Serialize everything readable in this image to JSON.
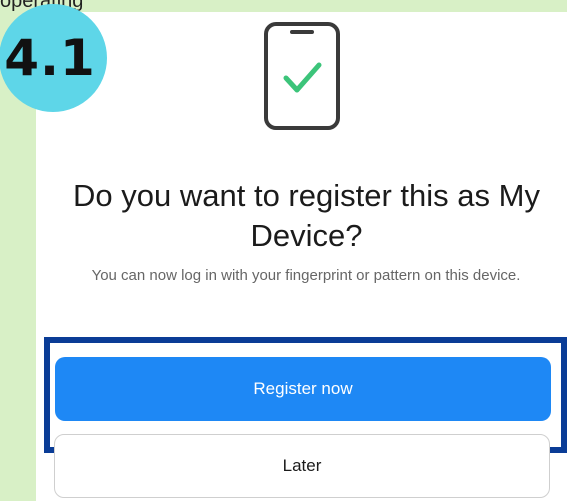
{
  "caption": "operating",
  "step_badge": "4.1",
  "icons": {
    "device": "smartphone-check-icon"
  },
  "colors": {
    "page_background": "#d8f0c6",
    "badge": "#5ed6e8",
    "primary_button": "#1e88f5",
    "highlight_frame": "#0a3c96",
    "check_mark": "#3cc47a"
  },
  "dialog": {
    "title": "Do you want to register this as My Device?",
    "subtitle": "You can now log in with your fingerprint or pattern on this device.",
    "primary_button": "Register now",
    "secondary_button": "Later"
  }
}
